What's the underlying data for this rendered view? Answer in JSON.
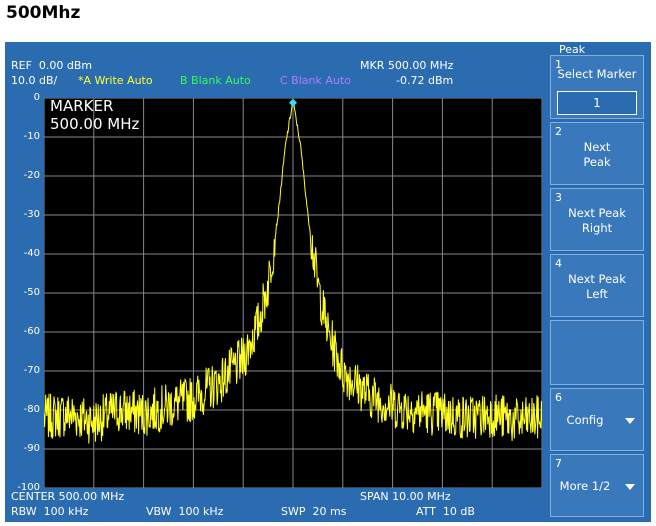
{
  "page_title": "500Mhz",
  "header": {
    "ref": "REF  0.00 dBm",
    "scale": "10.0 dB/",
    "trace_a": "*A Write Auto",
    "trace_b": "B Blank Auto",
    "trace_c": "C Blank Auto",
    "marker_freq": "MKR 500.00 MHz",
    "marker_level": "-0.72 dBm"
  },
  "marker_overlay": {
    "line1": "MARKER",
    "line2": "500.00 MHz"
  },
  "y_ticks": [
    "0",
    "-10",
    "-20",
    "-30",
    "-40",
    "-50",
    "-60",
    "-70",
    "-80",
    "-90",
    "-100"
  ],
  "footer": {
    "center": "CENTER 500.00 MHz",
    "span": "SPAN 10.00 MHz",
    "rbw": "RBW  100 kHz",
    "vbw": "VBW  100 kHz",
    "swp": "SWP  20 ms",
    "att": "ATT  10 dB"
  },
  "softkeys": {
    "panel_title": "Peak",
    "k1_num": "1",
    "k1_label": "Select Marker",
    "k1_value": "1",
    "k2_num": "2",
    "k2_label": "Next\nPeak",
    "k3_num": "3",
    "k3_label": "Next Peak\nRight",
    "k4_num": "4",
    "k4_label": "Next Peak\nLeft",
    "k6_num": "6",
    "k6_label": "Config",
    "k7_num": "7",
    "k7_label": "More 1/2"
  },
  "colors": {
    "panel_bg": "#2b6bb0",
    "trace": "#ffff22",
    "marker": "#33ddff",
    "grid": "#888888"
  },
  "icons": [
    "dropdown-arrow-icon"
  ],
  "chart_data": {
    "type": "line",
    "xlabel": "",
    "ylabel": "",
    "x_range_mhz": [
      495,
      505
    ],
    "ylim": [
      -100,
      0
    ],
    "y_unit": "dBm",
    "grid": true,
    "peak": {
      "x_mhz": 500.0,
      "y_dbm": -0.72
    },
    "series": [
      {
        "x_mhz": [
          495.0,
          495.5,
          496.0,
          496.5,
          497.0,
          497.5,
          498.0,
          498.5,
          499.0,
          499.3,
          499.5,
          499.7,
          499.85,
          500.0,
          500.15,
          500.3,
          500.5,
          500.7,
          501.0,
          501.5,
          502.0,
          502.5,
          503.0,
          503.5,
          504.0,
          504.5,
          505.0
        ],
        "y_dbm": [
          -82,
          -81,
          -83,
          -80,
          -81,
          -79,
          -77,
          -73,
          -67,
          -58,
          -48,
          -30,
          -12,
          -0.72,
          -12,
          -30,
          -48,
          -60,
          -70,
          -76,
          -79,
          -80,
          -81,
          -82,
          -81,
          -83,
          -82
        ]
      }
    ]
  }
}
